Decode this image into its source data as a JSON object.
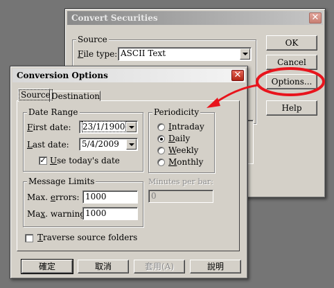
{
  "convert_securities": {
    "title": "Convert Securities",
    "source_group_label": "Source",
    "file_type_label": "File type:",
    "file_type_value": "ASCII Text",
    "buttons": {
      "ok": "OK",
      "cancel": "Cancel",
      "options": "Options...",
      "help": "Help"
    }
  },
  "conversion_options": {
    "title": "Conversion Options",
    "tabs": [
      "Source",
      "Destination"
    ],
    "date_range": {
      "label": "Date Range",
      "first_date_label": "First date:",
      "first_date_value": "23/1/1900",
      "last_date_label": "Last date:",
      "last_date_value": "5/4/2009",
      "use_today_label": "Use today's date"
    },
    "periodicity": {
      "label": "Periodicity",
      "options": [
        "Intraday",
        "Daily",
        "Weekly",
        "Monthly"
      ],
      "selected": "Daily"
    },
    "minutes_per_bar_label": "Minutes per bar:",
    "minutes_per_bar_value": "0",
    "message_limits": {
      "label": "Message Limits",
      "max_errors_label": "Max. errors:",
      "max_errors_value": "1000",
      "max_warnings_label": "Max. warnings:",
      "max_warnings_value": "1000"
    },
    "traverse_label": "Traverse source folders",
    "buttons": {
      "ok": "確定",
      "cancel": "取消",
      "apply": "套用(A)",
      "help": "說明"
    }
  },
  "annotation": {
    "color": "#e8141c"
  }
}
